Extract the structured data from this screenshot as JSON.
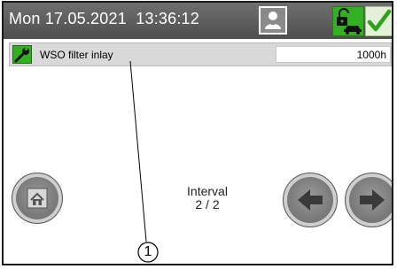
{
  "header": {
    "datetime": "Mon 17.05.2021  13:36:12",
    "icons": [
      "user-icon",
      "lock-open-car-icon",
      "checkmark-icon"
    ]
  },
  "row": {
    "icon": "wrench-icon",
    "label": "WSO filter inlay",
    "value": "1000h"
  },
  "footer": {
    "interval_label": "Interval",
    "interval_value": "2 / 2",
    "icons": [
      "home-icon",
      "arrow-left-icon",
      "arrow-right-icon"
    ]
  },
  "callout": {
    "number": "1"
  },
  "colors": {
    "header_bg": "#5e5e5e",
    "accent_green": "#33b021",
    "row_bg": "#d9d9d9"
  }
}
